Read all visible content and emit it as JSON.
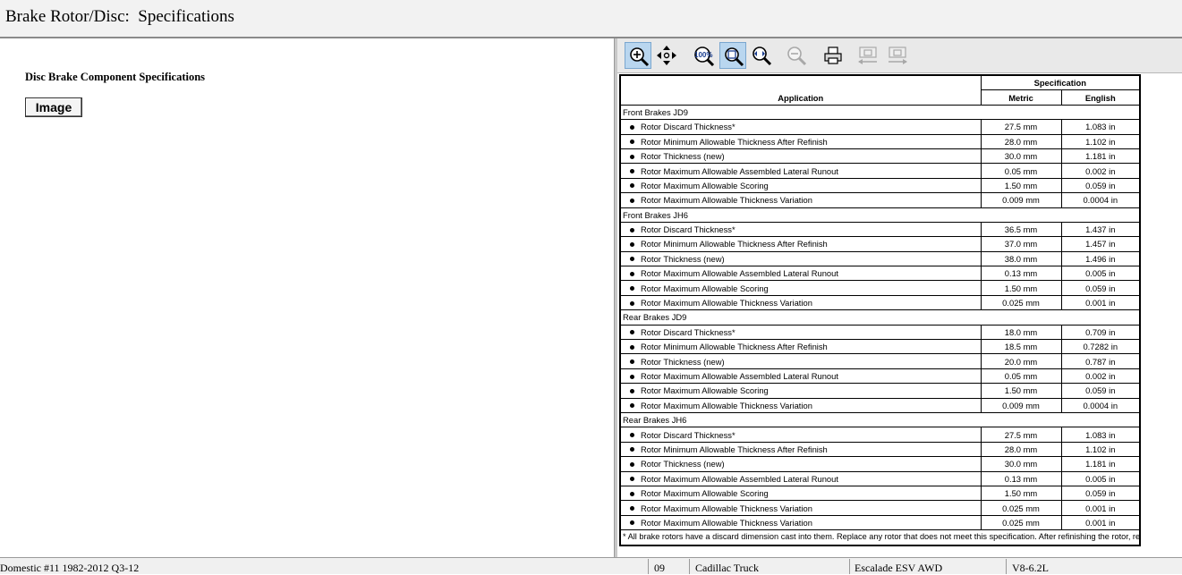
{
  "window": {
    "title": "Brake Rotor/Disc:  Specifications"
  },
  "left": {
    "heading": "Disc Brake Component Specifications",
    "image_button": "Image"
  },
  "toolbar": {
    "buttons": [
      {
        "name": "zoom-in",
        "active": true
      },
      {
        "name": "pan",
        "active": false
      },
      {
        "name": "actual-size-100",
        "label": "100%",
        "active": false
      },
      {
        "name": "fit-page",
        "active": true
      },
      {
        "name": "zoom-fit",
        "active": false
      },
      {
        "name": "zoom-out",
        "active": false
      },
      {
        "name": "print",
        "active": false
      },
      {
        "name": "prev-page",
        "active": false
      },
      {
        "name": "next-page",
        "active": false
      }
    ]
  },
  "table": {
    "header": {
      "application": "Application",
      "specification": "Specification",
      "metric": "Metric",
      "english": "English"
    },
    "groups": [
      {
        "name": "Front Brakes JD9",
        "rows": [
          {
            "item": "Rotor Discard Thickness*",
            "metric": "27.5 mm",
            "english": "1.083 in"
          },
          {
            "item": "Rotor Minimum Allowable Thickness After Refinish",
            "metric": "28.0 mm",
            "english": "1.102 in"
          },
          {
            "item": "Rotor Thickness (new)",
            "metric": "30.0 mm",
            "english": "1.181 in"
          },
          {
            "item": "Rotor Maximum Allowable Assembled Lateral Runout",
            "metric": "0.05 mm",
            "english": "0.002 in"
          },
          {
            "item": "Rotor Maximum Allowable Scoring",
            "metric": "1.50 mm",
            "english": "0.059 in"
          },
          {
            "item": "Rotor Maximum Allowable Thickness Variation",
            "metric": "0.009 mm",
            "english": "0.0004 in"
          }
        ]
      },
      {
        "name": "Front Brakes JH6",
        "rows": [
          {
            "item": "Rotor Discard Thickness*",
            "metric": "36.5 mm",
            "english": "1.437 in"
          },
          {
            "item": "Rotor Minimum Allowable Thickness After Refinish",
            "metric": "37.0 mm",
            "english": "1.457 in"
          },
          {
            "item": "Rotor Thickness (new)",
            "metric": "38.0 mm",
            "english": "1.496 in"
          },
          {
            "item": "Rotor Maximum Allowable Assembled Lateral Runout",
            "metric": "0.13 mm",
            "english": "0.005 in"
          },
          {
            "item": "Rotor Maximum Allowable Scoring",
            "metric": "1.50 mm",
            "english": "0.059 in"
          },
          {
            "item": "Rotor Maximum Allowable Thickness Variation",
            "metric": "0.025 mm",
            "english": "0.001 in"
          }
        ]
      },
      {
        "name": "Rear Brakes JD9",
        "rows": [
          {
            "item": "Rotor Discard Thickness*",
            "metric": "18.0 mm",
            "english": "0.709 in"
          },
          {
            "item": "Rotor Minimum Allowable Thickness After Refinish",
            "metric": "18.5 mm",
            "english": "0.7282 in"
          },
          {
            "item": "Rotor Thickness (new)",
            "metric": "20.0 mm",
            "english": "0.787 in"
          },
          {
            "item": "Rotor Maximum Allowable Assembled Lateral Runout",
            "metric": "0.05 mm",
            "english": "0.002 in"
          },
          {
            "item": "Rotor Maximum Allowable Scoring",
            "metric": "1.50 mm",
            "english": "0.059 in"
          },
          {
            "item": "Rotor Maximum Allowable Thickness Variation",
            "metric": "0.009 mm",
            "english": "0.0004 in"
          }
        ]
      },
      {
        "name": "Rear Brakes JH6",
        "rows": [
          {
            "item": "Rotor Discard Thickness*",
            "metric": "27.5 mm",
            "english": "1.083 in"
          },
          {
            "item": "Rotor Minimum Allowable Thickness After Refinish",
            "metric": "28.0 mm",
            "english": "1.102 in"
          },
          {
            "item": "Rotor Thickness (new)",
            "metric": "30.0 mm",
            "english": "1.181 in"
          },
          {
            "item": "Rotor Maximum Allowable Assembled Lateral Runout",
            "metric": "0.13 mm",
            "english": "0.005 in"
          },
          {
            "item": "Rotor Maximum Allowable Scoring",
            "metric": "1.50 mm",
            "english": "0.059 in"
          },
          {
            "item": "Rotor Maximum Allowable Thickness Variation",
            "metric": "0.025 mm",
            "english": "0.001 in"
          },
          {
            "item": "Rotor Maximum Allowable Thickness Variation",
            "metric": "0.025 mm",
            "english": "0.001 in"
          }
        ]
      }
    ],
    "footnote": "* All brake rotors have a discard dimension cast into them. Replace any rotor that does not meet this specification. After refinishing the rotor, replace any rotor that does not meet the minimum thickness specifications."
  },
  "status": {
    "source": "Domestic #11 1982-2012 Q3-12",
    "year": "09",
    "make": "Cadillac Truck",
    "model": "Escalade ESV AWD",
    "engine": "V8-6.2L"
  }
}
